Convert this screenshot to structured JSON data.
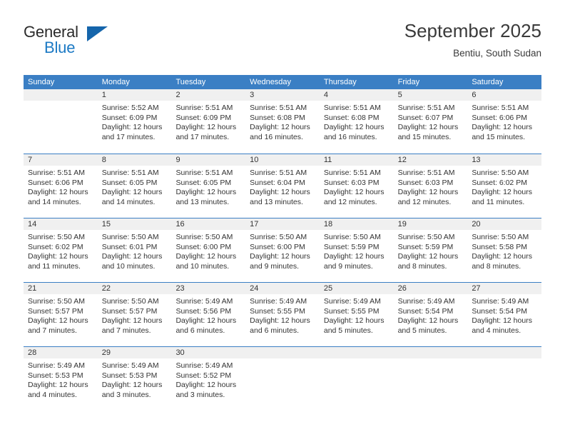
{
  "brand": {
    "name_part1": "General",
    "name_part2": "Blue",
    "accent_color": "#1b79c4",
    "triangle_color": "#1565ab"
  },
  "header": {
    "title": "September 2025",
    "subtitle": "Bentiu, South Sudan"
  },
  "calendar": {
    "header_bg": "#3b7fc4",
    "day_band_bg": "#f0f0f0",
    "weekdays": [
      "Sunday",
      "Monday",
      "Tuesday",
      "Wednesday",
      "Thursday",
      "Friday",
      "Saturday"
    ],
    "weeks": [
      [
        {
          "day": "",
          "lines": []
        },
        {
          "day": "1",
          "lines": [
            "Sunrise: 5:52 AM",
            "Sunset: 6:09 PM",
            "Daylight: 12 hours",
            "and 17 minutes."
          ]
        },
        {
          "day": "2",
          "lines": [
            "Sunrise: 5:51 AM",
            "Sunset: 6:09 PM",
            "Daylight: 12 hours",
            "and 17 minutes."
          ]
        },
        {
          "day": "3",
          "lines": [
            "Sunrise: 5:51 AM",
            "Sunset: 6:08 PM",
            "Daylight: 12 hours",
            "and 16 minutes."
          ]
        },
        {
          "day": "4",
          "lines": [
            "Sunrise: 5:51 AM",
            "Sunset: 6:08 PM",
            "Daylight: 12 hours",
            "and 16 minutes."
          ]
        },
        {
          "day": "5",
          "lines": [
            "Sunrise: 5:51 AM",
            "Sunset: 6:07 PM",
            "Daylight: 12 hours",
            "and 15 minutes."
          ]
        },
        {
          "day": "6",
          "lines": [
            "Sunrise: 5:51 AM",
            "Sunset: 6:06 PM",
            "Daylight: 12 hours",
            "and 15 minutes."
          ]
        }
      ],
      [
        {
          "day": "7",
          "lines": [
            "Sunrise: 5:51 AM",
            "Sunset: 6:06 PM",
            "Daylight: 12 hours",
            "and 14 minutes."
          ]
        },
        {
          "day": "8",
          "lines": [
            "Sunrise: 5:51 AM",
            "Sunset: 6:05 PM",
            "Daylight: 12 hours",
            "and 14 minutes."
          ]
        },
        {
          "day": "9",
          "lines": [
            "Sunrise: 5:51 AM",
            "Sunset: 6:05 PM",
            "Daylight: 12 hours",
            "and 13 minutes."
          ]
        },
        {
          "day": "10",
          "lines": [
            "Sunrise: 5:51 AM",
            "Sunset: 6:04 PM",
            "Daylight: 12 hours",
            "and 13 minutes."
          ]
        },
        {
          "day": "11",
          "lines": [
            "Sunrise: 5:51 AM",
            "Sunset: 6:03 PM",
            "Daylight: 12 hours",
            "and 12 minutes."
          ]
        },
        {
          "day": "12",
          "lines": [
            "Sunrise: 5:51 AM",
            "Sunset: 6:03 PM",
            "Daylight: 12 hours",
            "and 12 minutes."
          ]
        },
        {
          "day": "13",
          "lines": [
            "Sunrise: 5:50 AM",
            "Sunset: 6:02 PM",
            "Daylight: 12 hours",
            "and 11 minutes."
          ]
        }
      ],
      [
        {
          "day": "14",
          "lines": [
            "Sunrise: 5:50 AM",
            "Sunset: 6:02 PM",
            "Daylight: 12 hours",
            "and 11 minutes."
          ]
        },
        {
          "day": "15",
          "lines": [
            "Sunrise: 5:50 AM",
            "Sunset: 6:01 PM",
            "Daylight: 12 hours",
            "and 10 minutes."
          ]
        },
        {
          "day": "16",
          "lines": [
            "Sunrise: 5:50 AM",
            "Sunset: 6:00 PM",
            "Daylight: 12 hours",
            "and 10 minutes."
          ]
        },
        {
          "day": "17",
          "lines": [
            "Sunrise: 5:50 AM",
            "Sunset: 6:00 PM",
            "Daylight: 12 hours",
            "and 9 minutes."
          ]
        },
        {
          "day": "18",
          "lines": [
            "Sunrise: 5:50 AM",
            "Sunset: 5:59 PM",
            "Daylight: 12 hours",
            "and 9 minutes."
          ]
        },
        {
          "day": "19",
          "lines": [
            "Sunrise: 5:50 AM",
            "Sunset: 5:59 PM",
            "Daylight: 12 hours",
            "and 8 minutes."
          ]
        },
        {
          "day": "20",
          "lines": [
            "Sunrise: 5:50 AM",
            "Sunset: 5:58 PM",
            "Daylight: 12 hours",
            "and 8 minutes."
          ]
        }
      ],
      [
        {
          "day": "21",
          "lines": [
            "Sunrise: 5:50 AM",
            "Sunset: 5:57 PM",
            "Daylight: 12 hours",
            "and 7 minutes."
          ]
        },
        {
          "day": "22",
          "lines": [
            "Sunrise: 5:50 AM",
            "Sunset: 5:57 PM",
            "Daylight: 12 hours",
            "and 7 minutes."
          ]
        },
        {
          "day": "23",
          "lines": [
            "Sunrise: 5:49 AM",
            "Sunset: 5:56 PM",
            "Daylight: 12 hours",
            "and 6 minutes."
          ]
        },
        {
          "day": "24",
          "lines": [
            "Sunrise: 5:49 AM",
            "Sunset: 5:55 PM",
            "Daylight: 12 hours",
            "and 6 minutes."
          ]
        },
        {
          "day": "25",
          "lines": [
            "Sunrise: 5:49 AM",
            "Sunset: 5:55 PM",
            "Daylight: 12 hours",
            "and 5 minutes."
          ]
        },
        {
          "day": "26",
          "lines": [
            "Sunrise: 5:49 AM",
            "Sunset: 5:54 PM",
            "Daylight: 12 hours",
            "and 5 minutes."
          ]
        },
        {
          "day": "27",
          "lines": [
            "Sunrise: 5:49 AM",
            "Sunset: 5:54 PM",
            "Daylight: 12 hours",
            "and 4 minutes."
          ]
        }
      ],
      [
        {
          "day": "28",
          "lines": [
            "Sunrise: 5:49 AM",
            "Sunset: 5:53 PM",
            "Daylight: 12 hours",
            "and 4 minutes."
          ]
        },
        {
          "day": "29",
          "lines": [
            "Sunrise: 5:49 AM",
            "Sunset: 5:53 PM",
            "Daylight: 12 hours",
            "and 3 minutes."
          ]
        },
        {
          "day": "30",
          "lines": [
            "Sunrise: 5:49 AM",
            "Sunset: 5:52 PM",
            "Daylight: 12 hours",
            "and 3 minutes."
          ]
        },
        {
          "day": "",
          "lines": []
        },
        {
          "day": "",
          "lines": []
        },
        {
          "day": "",
          "lines": []
        },
        {
          "day": "",
          "lines": []
        }
      ]
    ]
  }
}
